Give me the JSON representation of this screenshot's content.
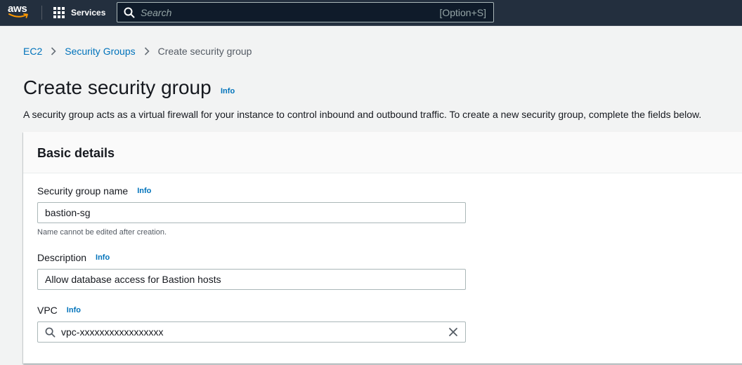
{
  "topnav": {
    "logo_text": "aws",
    "services_label": "Services",
    "search_placeholder": "Search",
    "search_shortcut": "[Option+S]"
  },
  "breadcrumb": {
    "items": [
      "EC2",
      "Security Groups"
    ],
    "current": "Create security group"
  },
  "header": {
    "title": "Create security group",
    "info_label": "Info",
    "description": "A security group acts as a virtual firewall for your instance to control inbound and outbound traffic. To create a new security group, complete the fields below."
  },
  "basic_details": {
    "title": "Basic details",
    "name_field": {
      "label": "Security group name",
      "info": "Info",
      "value": "bastion-sg",
      "constraint": "Name cannot be edited after creation."
    },
    "description_field": {
      "label": "Description",
      "info": "Info",
      "value": "Allow database access for Bastion hosts"
    },
    "vpc_field": {
      "label": "VPC",
      "info": "Info",
      "value": "vpc-xxxxxxxxxxxxxxxxx"
    }
  },
  "colors": {
    "nav_bg": "#232f3e",
    "link": "#0073bb",
    "page_bg": "#f2f3f3",
    "aws_smile": "#ff9900"
  },
  "icons": {
    "logo": "aws-logo-icon",
    "services": "grid-icon",
    "search": "search-icon",
    "breadcrumb_separator": "chevron-right-icon",
    "clear": "close-icon"
  }
}
